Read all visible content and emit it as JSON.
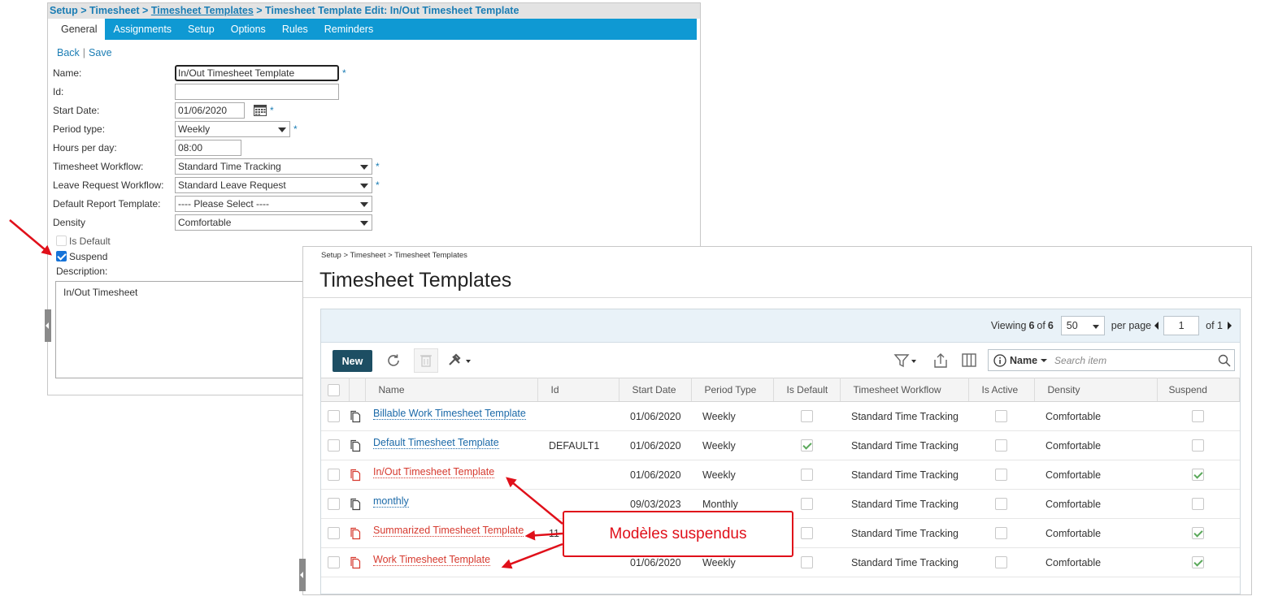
{
  "edit": {
    "breadcrumb": {
      "part1": "Setup > Timesheet > ",
      "part2": "Timesheet Templates",
      "part3": " > Timesheet Template Edit: In/Out Timesheet Template"
    },
    "tabs": [
      "General",
      "Assignments",
      "Setup",
      "Options",
      "Rules",
      "Reminders"
    ],
    "links": {
      "back": "Back",
      "separator": "|",
      "save": "Save"
    },
    "fields": {
      "name": {
        "label": "Name:",
        "value": "In/Out Timesheet Template",
        "required": "*"
      },
      "id": {
        "label": "Id:",
        "value": ""
      },
      "start_date": {
        "label": "Start Date:",
        "value": "01/06/2020",
        "required": "*"
      },
      "period_type": {
        "label": "Period type:",
        "value": "Weekly",
        "required": "*"
      },
      "hours_per_day": {
        "label": "Hours per day:",
        "value": "08:00"
      },
      "timesheet_workflow": {
        "label": "Timesheet Workflow:",
        "value": "Standard Time Tracking",
        "required": "*"
      },
      "leave_request_workflow": {
        "label": "Leave Request Workflow:",
        "value": "Standard Leave Request",
        "required": "*"
      },
      "default_report_template": {
        "label": "Default Report Template:",
        "value": "---- Please Select ----"
      },
      "density": {
        "label": "Density",
        "value": "Comfortable"
      }
    },
    "is_default": {
      "label": "Is Default",
      "checked": false
    },
    "suspend": {
      "label": "Suspend",
      "checked": true
    },
    "description": {
      "label": "Description:",
      "value": "In/Out Timesheet"
    }
  },
  "list": {
    "breadcrumb": "Setup > Timesheet > Timesheet Templates",
    "title": "Timesheet Templates",
    "pager": {
      "viewing": "Viewing",
      "shown": "6",
      "of": "of",
      "total": "6",
      "page_size": "50",
      "per_page": "per page",
      "page": "1",
      "of_pages": "of 1"
    },
    "toolbar": {
      "new_label": "New"
    },
    "search": {
      "field": "Name",
      "placeholder": "Search item"
    },
    "columns": [
      "Name",
      "Id",
      "Start Date",
      "Period Type",
      "Is Default",
      "Timesheet Workflow",
      "Is Active",
      "Density",
      "Suspend"
    ],
    "rows": [
      {
        "name": "Billable Work Timesheet Template",
        "id": "",
        "start_date": "01/06/2020",
        "period_type": "Weekly",
        "is_default": false,
        "workflow": "Standard Time Tracking",
        "is_active": false,
        "density": "Comfortable",
        "suspend": false
      },
      {
        "name": "Default Timesheet Template",
        "id": "DEFAULT1",
        "start_date": "01/06/2020",
        "period_type": "Weekly",
        "is_default": true,
        "workflow": "Standard Time Tracking",
        "is_active": false,
        "density": "Comfortable",
        "suspend": false
      },
      {
        "name": "In/Out Timesheet Template",
        "id": "",
        "start_date": "01/06/2020",
        "period_type": "Weekly",
        "is_default": false,
        "workflow": "Standard Time Tracking",
        "is_active": false,
        "density": "Comfortable",
        "suspend": true
      },
      {
        "name": "monthly",
        "id": "",
        "start_date": "09/03/2023",
        "period_type": "Monthly",
        "is_default": false,
        "workflow": "Standard Time Tracking",
        "is_active": false,
        "density": "Comfortable",
        "suspend": false
      },
      {
        "name": "Summarized Timesheet Template",
        "id": "11",
        "start_date": "",
        "period_type": "",
        "is_default": false,
        "workflow": "Standard Time Tracking",
        "is_active": false,
        "density": "Comfortable",
        "suspend": true
      },
      {
        "name": "Work Timesheet Template",
        "id": "",
        "start_date": "01/06/2020",
        "period_type": "Weekly",
        "is_default": false,
        "workflow": "Standard Time Tracking",
        "is_active": false,
        "density": "Comfortable",
        "suspend": true
      }
    ]
  },
  "annotation": {
    "callout": "Modèles suspendus",
    "color": "#e0101a"
  },
  "colors": {
    "tab_bar": "#0f99d3",
    "link": "#1b69a8",
    "suspended_row": "#d63a2f",
    "new_button": "#1d4e63"
  }
}
